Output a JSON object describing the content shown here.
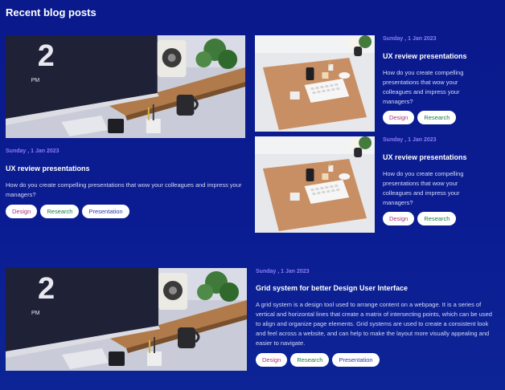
{
  "section": {
    "title": "Recent blog posts"
  },
  "posts": [
    {
      "date": "Sunday , 1 Jan 2023",
      "title": "UX review presentations",
      "description": "How do you create compelling presentations that wow your colleagues and impress your managers?",
      "tags": [
        "Design",
        "Research",
        "Presentation"
      ]
    },
    {
      "date": "Sunday , 1 Jan 2023",
      "title": "UX review presentations",
      "description": "How do you create compelling presentations that wow your colleagues and impress your managers?",
      "tags": [
        "Design",
        "Research"
      ]
    },
    {
      "date": "Sunday , 1 Jan 2023",
      "title": "UX review presentations",
      "description": "How do you create compelling presentations that wow your colleagues and impress your managers?",
      "tags": [
        "Design",
        "Research"
      ]
    },
    {
      "date": "Sunday , 1 Jan 2023",
      "title": "Grid system for better Design User Interface",
      "description": "A grid system is a design tool used to arrange content on a webpage. It is a series of vertical and horizontal lines that create a matrix of intersecting points, which can be used to align and organize page elements. Grid systems are used to create a consistent look and feel across a website, and can help to make the layout more visually appealing and easier to navigate.",
      "tags": [
        "Design",
        "Research",
        "Presentation"
      ]
    }
  ],
  "colors": {
    "background": "#0b1c92",
    "date": "#8b7cf6",
    "tag_design": "#b0307a",
    "tag_research": "#1a7a46",
    "tag_presentation": "#2c3aa8"
  }
}
